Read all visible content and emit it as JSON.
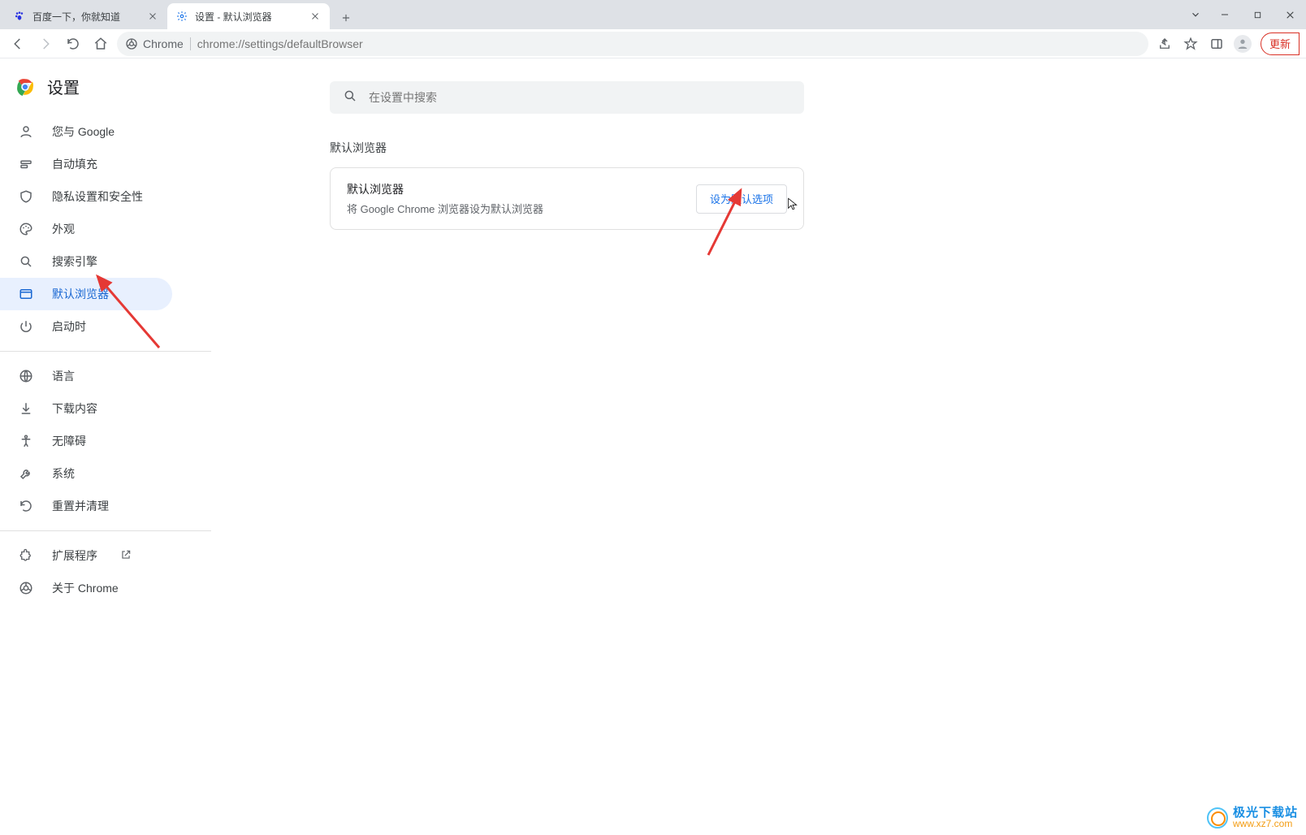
{
  "tabs": {
    "items": [
      {
        "title": "百度一下，你就知道",
        "favicon": "baidu-paw-icon"
      },
      {
        "title": "设置 - 默认浏览器",
        "favicon": "gear-icon"
      }
    ]
  },
  "toolbar": {
    "secure_label": "Chrome",
    "url": "chrome://settings/defaultBrowser",
    "update_label": "更新"
  },
  "settings": {
    "title": "设置",
    "search_placeholder": "在设置中搜索",
    "sidebar": [
      {
        "id": "you-and-google",
        "icon": "person-icon",
        "label": "您与 Google"
      },
      {
        "id": "autofill",
        "icon": "autofill-icon",
        "label": "自动填充"
      },
      {
        "id": "privacy",
        "icon": "shield-icon",
        "label": "隐私设置和安全性"
      },
      {
        "id": "appearance",
        "icon": "palette-icon",
        "label": "外观"
      },
      {
        "id": "search-engine",
        "icon": "search-icon",
        "label": "搜索引擎"
      },
      {
        "id": "default-browser",
        "icon": "browser-icon",
        "label": "默认浏览器"
      },
      {
        "id": "on-startup",
        "icon": "power-icon",
        "label": "启动时"
      }
    ],
    "sidebar2": [
      {
        "id": "languages",
        "icon": "globe-icon",
        "label": "语言"
      },
      {
        "id": "downloads",
        "icon": "download-icon",
        "label": "下载内容"
      },
      {
        "id": "accessibility",
        "icon": "accessibility-icon",
        "label": "无障碍"
      },
      {
        "id": "system",
        "icon": "wrench-icon",
        "label": "系统"
      },
      {
        "id": "reset",
        "icon": "restore-icon",
        "label": "重置并清理"
      }
    ],
    "sidebar3": [
      {
        "id": "extensions",
        "icon": "puzzle-icon",
        "label": "扩展程序",
        "external": true
      },
      {
        "id": "about",
        "icon": "chrome-outline-icon",
        "label": "关于 Chrome"
      }
    ]
  },
  "panel": {
    "section_title": "默认浏览器",
    "card_title": "默认浏览器",
    "card_subtitle": "将 Google Chrome 浏览器设为默认浏览器",
    "button_label": "设为默认选项"
  },
  "watermark": {
    "line1": "极光下载站",
    "line2": "www.xz7.com"
  }
}
